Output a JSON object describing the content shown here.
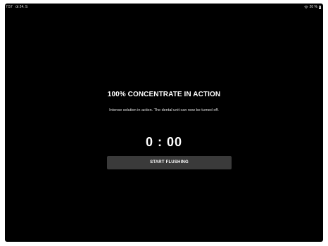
{
  "status_bar": {
    "time": "7:57",
    "date": "út 24. 9.",
    "battery": "20 %",
    "wifi_icon": "wifi-icon",
    "battery_icon": "battery-icon"
  },
  "main": {
    "title": "100% CONCENTRATE IN ACTION",
    "subtitle": "Intense solution in action. The dental unit can now be turned off.",
    "timer": "0 : 00",
    "start_button_label": "START FLUSHING"
  },
  "colors": {
    "background": "#000000",
    "button": "#3a3a3a",
    "text": "#ffffff"
  }
}
